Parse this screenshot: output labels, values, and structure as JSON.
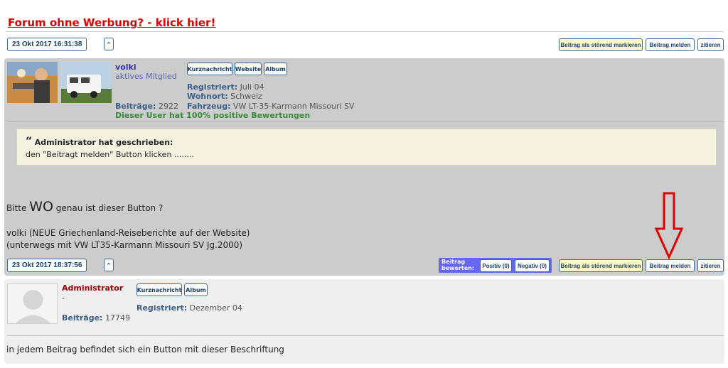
{
  "banner": {
    "text": "Forum ohne Werbung? - klick hier!"
  },
  "post1_bar": {
    "date": "23 Okt 2017 16:31:38",
    "arrow": "^",
    "mark_label": "Beitrag als störend markieren",
    "report_label": "Beitrag melden",
    "quote_label": "zitieren"
  },
  "post1": {
    "username": "volki",
    "rank": "aktives Mitglied",
    "buttons": [
      "Kurznachricht",
      "Website",
      "Album"
    ],
    "registered_label": "Registriert:",
    "registered_value": "Juli 04",
    "residence_label": "Wohnort:",
    "residence_value": "Schweiz",
    "posts_label": "Beiträge:",
    "posts_value": "2922",
    "vehicle_label": "Fahrzeug:",
    "vehicle_value": "VW LT-35-Karmann Missouri SV",
    "rating_text": "Dieser User hat 100% positive Bewertungen",
    "quote_author": "Administrator hat geschrieben:",
    "quote_text": "den \"Beitragt melden\" Button klicken ........",
    "body_pre": "Bitte",
    "body_big": "WO",
    "body_post": "genau ist dieser Button ?",
    "signature_line1": "volki (NEUE Griechenland-Reiseberichte auf der Website)",
    "signature_line2": "(unterwegs mit VW LT35-Karmann Missouri SV Jg.2000)"
  },
  "post2_bar": {
    "date": "23 Okt 2017 18:37:56",
    "arrow": "^",
    "rate_label_1": "Beitrag",
    "rate_label_2": "bewerten:",
    "positive": "Positiv (0)",
    "negative": "Negativ (0)",
    "mark_label": "Beitrag als störend markieren",
    "report_label": "Beitrag melden",
    "quote_label": "zitieren"
  },
  "post2": {
    "username": "Administrator",
    "rank": "-",
    "buttons": [
      "Kurznachricht",
      "Album"
    ],
    "registered_label": "Registriert:",
    "registered_value": "Dezember 04",
    "posts_label": "Beiträge:",
    "posts_value": "17749",
    "body": "in jedem Beitrag befindet sich ein Button mit dieser Beschriftung"
  },
  "colors": {
    "post_bg": "#cccccc",
    "post2_bg": "#efefef",
    "admin_name": "#a00000",
    "rating_green": "#3a8a3a",
    "annotation_arrow": "#e00000"
  }
}
